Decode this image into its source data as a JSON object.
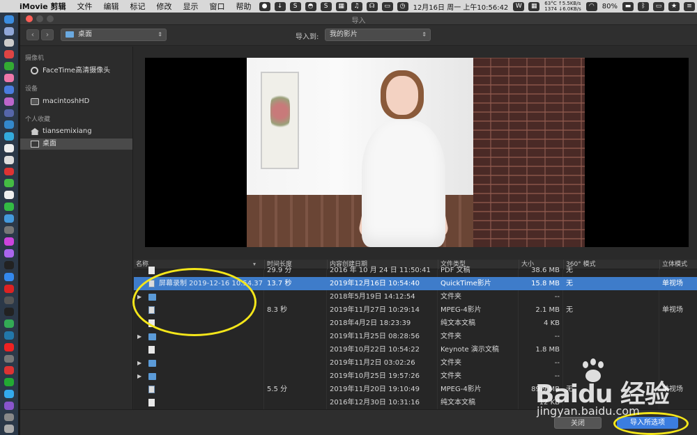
{
  "menubar": {
    "app_name": "iMovie 剪辑",
    "menus": [
      "文件",
      "编辑",
      "标记",
      "修改",
      "显示",
      "窗口",
      "帮助"
    ],
    "datetime": "12月16日 周一 上午10:56:42",
    "temp": "63°C",
    "cpu": "1374",
    "net_up": "↑5.5KB/s",
    "net_down": "↓6.0KB/s",
    "battery": "80%"
  },
  "window": {
    "title": "导入"
  },
  "toolbar": {
    "location": "桌面",
    "import_to_label": "导入到:",
    "library": "我的影片"
  },
  "sidebar": {
    "sections": [
      {
        "title": "摄像机",
        "items": [
          {
            "label": "FaceTime高清摄像头",
            "icon": "camera-icon"
          }
        ]
      },
      {
        "title": "设备",
        "items": [
          {
            "label": "macintoshHD",
            "icon": "disk-icon"
          }
        ]
      },
      {
        "title": "个人收藏",
        "items": [
          {
            "label": "tiansemixiang",
            "icon": "home-icon"
          },
          {
            "label": "桌面",
            "icon": "desktop-icon"
          }
        ]
      }
    ],
    "selected": "桌面"
  },
  "table": {
    "columns": [
      "名称",
      "时间长度",
      "内容创建日期",
      "文件类型",
      "大小",
      "360° 模式",
      "立体模式"
    ],
    "rows": [
      {
        "kind": "doc",
        "name": "",
        "duration": "29.9 分",
        "date": "2016 年 10 月 24 日 11:50:41",
        "type": "PDF 文稿",
        "size": "38.6 MB",
        "m360": "无",
        "stereo": ""
      },
      {
        "kind": "movie",
        "name": "屏幕录制 2019-12-16 10.54.37",
        "duration": "13.7 秒",
        "date": "2019年12月16日 10:54:40",
        "type": "QuickTime影片",
        "size": "15.8 MB",
        "m360": "无",
        "stereo": "单视场",
        "selected": true
      },
      {
        "kind": "folder",
        "name": "",
        "duration": "",
        "date": "2018年5月19日 14:12:54",
        "type": "文件夹",
        "size": "--",
        "m360": "",
        "stereo": ""
      },
      {
        "kind": "movie",
        "name": "",
        "duration": "8.3 秒",
        "date": "2019年11月27日 10:29:14",
        "type": "MPEG-4影片",
        "size": "2.1 MB",
        "m360": "无",
        "stereo": "单视场"
      },
      {
        "kind": "doc",
        "name": "",
        "duration": "",
        "date": "2018年4月2日 18:23:39",
        "type": "纯文本文稿",
        "size": "4 KB",
        "m360": "",
        "stereo": ""
      },
      {
        "kind": "folder",
        "name": "",
        "duration": "",
        "date": "2019年11月25日 08:28:56",
        "type": "文件夹",
        "size": "--",
        "m360": "",
        "stereo": ""
      },
      {
        "kind": "doc",
        "name": "",
        "duration": "",
        "date": "2019年10月22日 10:54:22",
        "type": "Keynote 演示文稿",
        "size": "1.8 MB",
        "m360": "",
        "stereo": ""
      },
      {
        "kind": "folder",
        "name": "",
        "duration": "",
        "date": "2019年11月2日 03:02:26",
        "type": "文件夹",
        "size": "--",
        "m360": "",
        "stereo": ""
      },
      {
        "kind": "folder",
        "name": "",
        "duration": "",
        "date": "2019年10月25日 19:57:26",
        "type": "文件夹",
        "size": "--",
        "m360": "",
        "stereo": ""
      },
      {
        "kind": "movie",
        "name": "",
        "duration": "5.5 分",
        "date": "2019年11月20日 19:10:49",
        "type": "MPEG-4影片",
        "size": "89.9 MB",
        "m360": "无",
        "stereo": "单视场"
      },
      {
        "kind": "doc",
        "name": "",
        "duration": "",
        "date": "2016年12月30日 10:31:16",
        "type": "纯文本文稿",
        "size": "12 KB",
        "m360": "",
        "stereo": ""
      }
    ]
  },
  "buttons": {
    "close": "关闭",
    "import_selected": "导入所选项"
  },
  "watermark": {
    "logo": "Baidu 经验",
    "url": "jingyan.baidu.com"
  },
  "colors": {
    "selection": "#3e7cca",
    "primary_button": "#3b7de0",
    "highlight_annotation": "#f4e61a"
  }
}
